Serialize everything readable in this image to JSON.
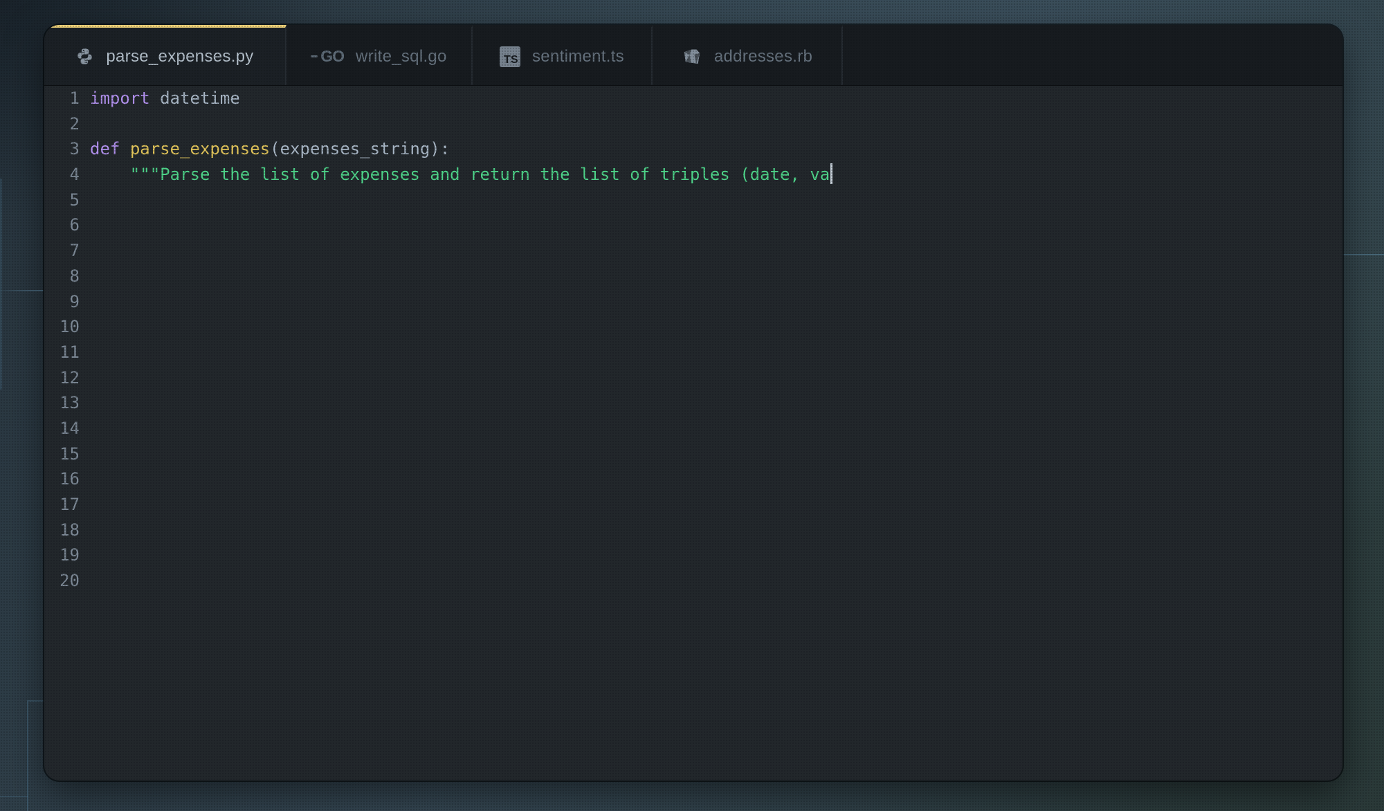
{
  "tabs": [
    {
      "label": "parse_expenses.py",
      "icon": "python-icon",
      "active": true
    },
    {
      "label": "write_sql.go",
      "icon": "go-icon",
      "active": false
    },
    {
      "label": "sentiment.ts",
      "icon": "typescript-icon",
      "active": false
    },
    {
      "label": "addresses.rb",
      "icon": "ruby-icon",
      "active": false
    }
  ],
  "editor": {
    "language": "python",
    "total_lines": 20,
    "cursor_line": 4,
    "lines": [
      {
        "num": "1",
        "cursor": false,
        "tokens": [
          {
            "text": "import",
            "type": "keyword"
          },
          {
            "text": " datetime",
            "type": "plain"
          }
        ]
      },
      {
        "num": "2",
        "cursor": false,
        "tokens": []
      },
      {
        "num": "3",
        "cursor": false,
        "tokens": [
          {
            "text": "def",
            "type": "keyword"
          },
          {
            "text": " ",
            "type": "plain"
          },
          {
            "text": "parse_expenses",
            "type": "function"
          },
          {
            "text": "(expenses_string):",
            "type": "plain"
          }
        ]
      },
      {
        "num": "4",
        "cursor": true,
        "tokens": [
          {
            "text": "    \"\"\"Parse the list of expenses and return the list of triples (date, va",
            "type": "string"
          }
        ]
      },
      {
        "num": "5",
        "cursor": false,
        "tokens": []
      },
      {
        "num": "6",
        "cursor": false,
        "tokens": []
      },
      {
        "num": "7",
        "cursor": false,
        "tokens": []
      },
      {
        "num": "8",
        "cursor": false,
        "tokens": []
      },
      {
        "num": "9",
        "cursor": false,
        "tokens": []
      },
      {
        "num": "10",
        "cursor": false,
        "tokens": []
      },
      {
        "num": "11",
        "cursor": false,
        "tokens": []
      },
      {
        "num": "12",
        "cursor": false,
        "tokens": []
      },
      {
        "num": "13",
        "cursor": false,
        "tokens": []
      },
      {
        "num": "14",
        "cursor": false,
        "tokens": []
      },
      {
        "num": "15",
        "cursor": false,
        "tokens": []
      },
      {
        "num": "16",
        "cursor": false,
        "tokens": []
      },
      {
        "num": "17",
        "cursor": false,
        "tokens": []
      },
      {
        "num": "18",
        "cursor": false,
        "tokens": []
      },
      {
        "num": "19",
        "cursor": false,
        "tokens": []
      },
      {
        "num": "20",
        "cursor": false,
        "tokens": []
      }
    ]
  },
  "colors": {
    "accent": "#eed178",
    "editor-bg": "#22272b",
    "tabbar-bg": "#171b1f",
    "tab-text": "#66727e",
    "tab-text-active": "#b3bfca",
    "line-number": "#7b8794",
    "keyword": "#b392f0",
    "plain": "#a9b7c6",
    "function": "#e2c55a",
    "string": "#4ed389",
    "cursor": "#ccd6df"
  }
}
